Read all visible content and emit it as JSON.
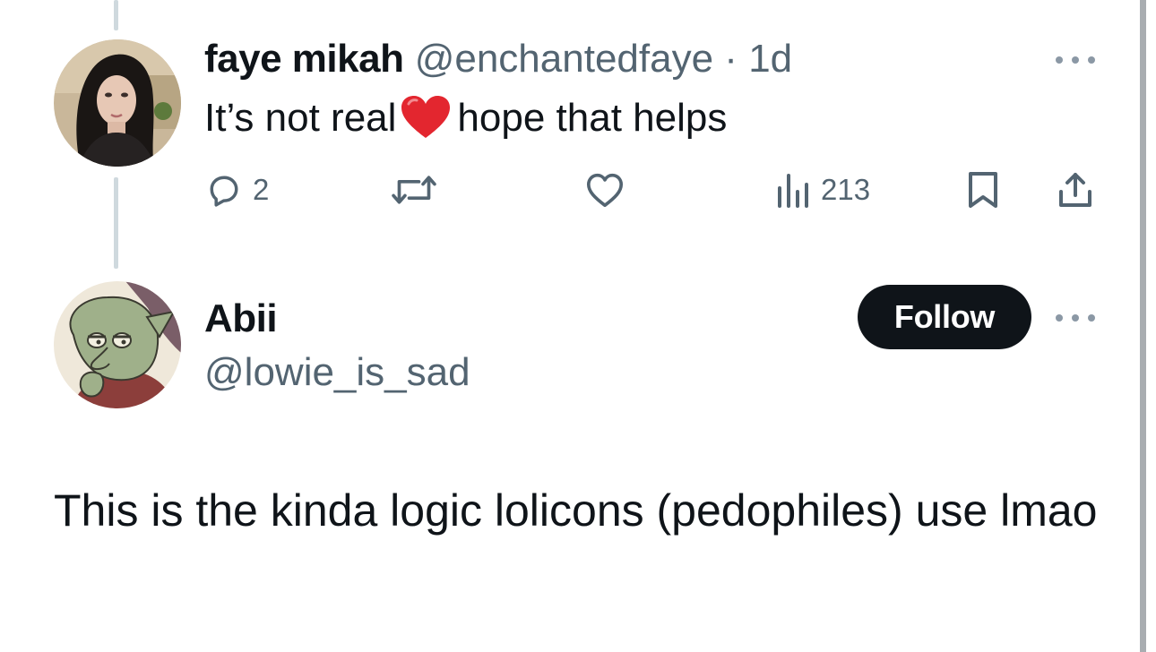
{
  "reply": {
    "display_name": "faye mikah",
    "handle": "@enchantedfaye",
    "separator": "·",
    "time": "1d",
    "text_before": "It’s not real",
    "emoji": "❤️",
    "text_after": "hope that helps",
    "actions": {
      "replies": "2",
      "reposts": "",
      "likes": "",
      "views": "213"
    }
  },
  "quoted": {
    "display_name": "Abii",
    "handle": "@lowie_is_sad",
    "follow_label": "Follow",
    "text": "This is the kinda logic lolicons (pedophiles) use lmao"
  },
  "icons": {
    "reply": "reply-icon",
    "repost": "repost-icon",
    "like": "heart-icon",
    "views": "views-chart-icon",
    "bookmark": "bookmark-icon",
    "share": "share-icon",
    "more": "more-icon"
  },
  "colors": {
    "text": "#0f1419",
    "secondary": "#536471",
    "thread_line": "#cfd9de",
    "button_bg": "#0f1419",
    "heart_emoji": "#e3262f"
  }
}
